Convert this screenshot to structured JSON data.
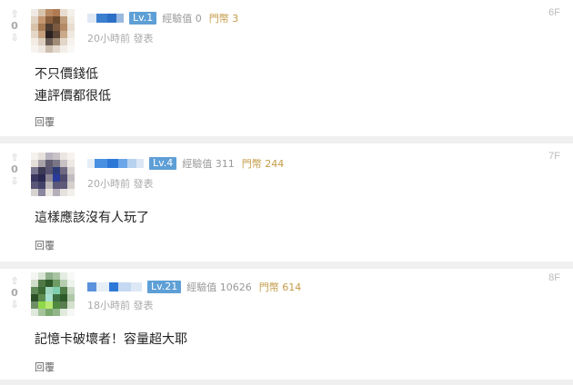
{
  "comments": [
    {
      "level": "Lv.1",
      "exp_label": "經驗值",
      "exp_value": "0",
      "gold_label": "門幣",
      "gold_value": "3",
      "time": "20小時前 發表",
      "floor": "6F",
      "votes": "0",
      "lines": [
        "不只價錢低",
        "連評價都很低"
      ],
      "reply_label": "回覆"
    },
    {
      "level": "Lv.4",
      "exp_label": "經驗值",
      "exp_value": "311",
      "gold_label": "門幣",
      "gold_value": "244",
      "time": "20小時前 發表",
      "floor": "7F",
      "votes": "0",
      "lines": [
        "這樣應該沒有人玩了"
      ],
      "reply_label": "回覆"
    },
    {
      "level": "Lv.21",
      "exp_label": "經驗值",
      "exp_value": "10626",
      "gold_label": "門幣",
      "gold_value": "614",
      "time": "18小時前 發表",
      "floor": "8F",
      "votes": "0",
      "lines": [
        "記憶卡破壞者！容量超大耶"
      ],
      "reply_label": "回覆"
    }
  ],
  "icons": {
    "upvote": "arrow-up-icon",
    "downvote": "arrow-down-icon"
  },
  "colors": {
    "level_badge": "#5e9fd6",
    "gold": "#c39b48",
    "separator": "#f0f0f0"
  }
}
